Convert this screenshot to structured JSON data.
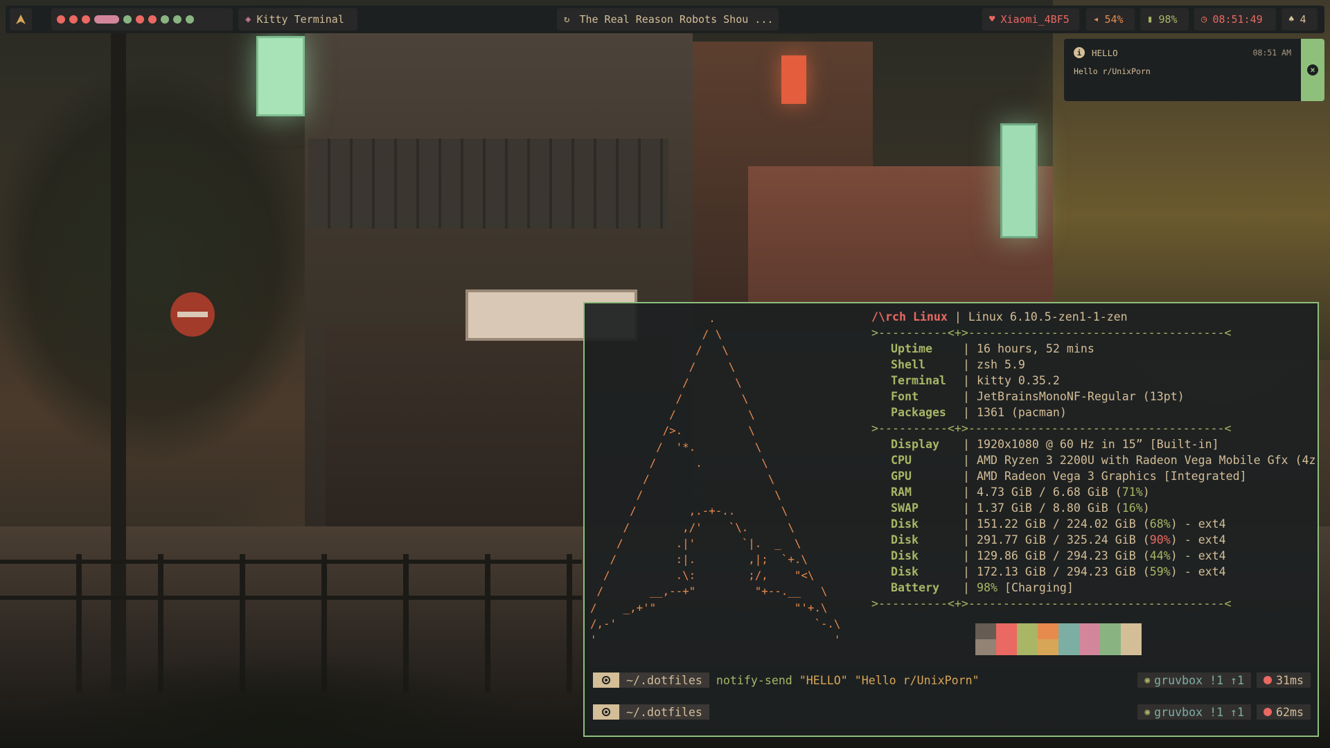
{
  "colors": {
    "bg": "#1d2021",
    "fg": "#d4be98",
    "red": "#ea6962",
    "orange": "#e78a4e",
    "yellow": "#d8a657",
    "green": "#a9b665",
    "aqua": "#89b482",
    "border": "#8ec07c"
  },
  "topbar": {
    "arch_icon": "arch-logo-icon",
    "workspaces": [
      {
        "color": "#ea6962",
        "shape": "dot"
      },
      {
        "color": "#ea6962",
        "shape": "dot"
      },
      {
        "color": "#ea6962",
        "shape": "dot"
      },
      {
        "color": "#d3869b",
        "shape": "pill"
      },
      {
        "color": "#89b482",
        "shape": "dot"
      },
      {
        "color": "#ea6962",
        "shape": "dot"
      },
      {
        "color": "#ea6962",
        "shape": "dot"
      },
      {
        "color": "#89b482",
        "shape": "dot"
      },
      {
        "color": "#89b482",
        "shape": "dot"
      },
      {
        "color": "#89b482",
        "shape": "dot"
      }
    ],
    "window_title": "Kitty Terminal",
    "window_icon": "cat-icon",
    "media_title": "The Real Reason Robots Shou ...",
    "media_icon": "spinner-icon",
    "wifi": "Xiaomi_4BF5",
    "volume": "54%",
    "battery": "98%",
    "clock": "08:51:49",
    "notification_count": "4"
  },
  "notification": {
    "app": "HELLO",
    "time": "08:51 AM",
    "body": "Hello r/UnixPorn"
  },
  "terminal": {
    "title": "/\\rch Linux",
    "kernel": "Linux 6.10.5-zen1-1-zen",
    "separator": ">----------<+>-------------------------------------<",
    "group1": [
      {
        "key": "Uptime",
        "value": "16 hours, 52 mins"
      },
      {
        "key": "Shell",
        "value": "zsh 5.9"
      },
      {
        "key": "Terminal",
        "value": "kitty 0.35.2"
      },
      {
        "key": "Font",
        "value": "JetBrainsMonoNF-Regular (13pt)"
      },
      {
        "key": "Packages",
        "value": "1361 (pacman)"
      }
    ],
    "group2": [
      {
        "key": "Display",
        "value": "1920x1080 @ 60 Hz in 15” [Built-in]"
      },
      {
        "key": "CPU",
        "value": "AMD Ryzen 3 2200U with Radeon Vega Mobile Gfx (4z"
      },
      {
        "key": "GPU",
        "value": "AMD Radeon Vega 3 Graphics [Integrated]"
      },
      {
        "key": "RAM",
        "pre": "4.73 GiB / 6.68 GiB (",
        "pct": "71%",
        "pct_color": "green",
        "post": ")"
      },
      {
        "key": "SWAP",
        "pre": "1.37 GiB / 8.80 GiB (",
        "pct": "16%",
        "pct_color": "green",
        "post": ")"
      },
      {
        "key": "Disk",
        "pre": "151.22 GiB / 224.02 GiB (",
        "pct": "68%",
        "pct_color": "green",
        "post": ") - ext4"
      },
      {
        "key": "Disk",
        "pre": "291.77 GiB / 325.24 GiB (",
        "pct": "90%",
        "pct_color": "red",
        "post": ") - ext4"
      },
      {
        "key": "Disk",
        "pre": "129.86 GiB / 294.23 GiB (",
        "pct": "44%",
        "pct_color": "green",
        "post": ") - ext4"
      },
      {
        "key": "Disk",
        "pre": "172.13 GiB / 294.23 GiB (",
        "pct": "59%",
        "pct_color": "green",
        "post": ") - ext4"
      },
      {
        "key": "Battery",
        "pre": "",
        "pct": "98%",
        "pct_color": "green",
        "post": " [Charging]"
      }
    ],
    "palette": [
      [
        "#665c54",
        "#928374"
      ],
      [
        "#ea6962",
        "#ea6962"
      ],
      [
        "#a9b665",
        "#a9b665"
      ],
      [
        "#e78a4e",
        "#d8a657"
      ],
      [
        "#7daea3",
        "#7daea3"
      ],
      [
        "#d3869b",
        "#d3869b"
      ],
      [
        "#89b482",
        "#89b482"
      ],
      [
        "#d4be98",
        "#d4be98"
      ]
    ],
    "prompts": [
      {
        "dir": "~/.dotfiles",
        "cmd_name": "notify-send",
        "cmd_args": "\"HELLO\" \"Hello r/UnixPorn\"",
        "git": "gruvbox !1 ↑1",
        "time": "31ms"
      },
      {
        "dir": "~/.dotfiles",
        "cmd_name": "",
        "cmd_args": "",
        "git": "gruvbox !1 ↑1",
        "time": "62ms"
      }
    ]
  }
}
